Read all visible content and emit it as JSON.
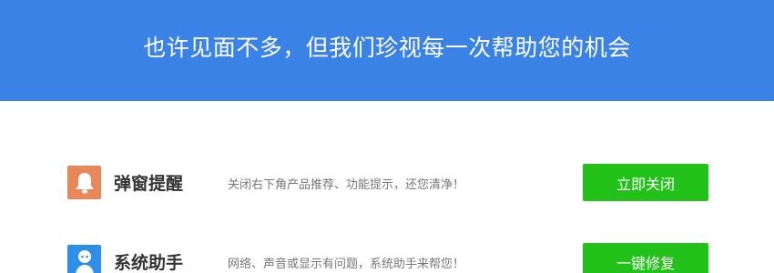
{
  "banner": {
    "title": "也许见面不多，但我们珍视每一次帮助您的机会",
    "color": "#3b82e6"
  },
  "rows": [
    {
      "title": "弹窗提醒",
      "description": "关闭右下角产品推荐、功能提示，还您清净！",
      "button_label": "立即关闭",
      "icon": "bell-icon",
      "icon_color": "#e8875a"
    },
    {
      "title": "系统助手",
      "description": "网络、声音或显示有问题，系统助手来帮您！",
      "button_label": "一键修复",
      "icon": "assistant-icon",
      "icon_color": "#2d8fe8"
    }
  ],
  "colors": {
    "button": "#22c21a"
  }
}
